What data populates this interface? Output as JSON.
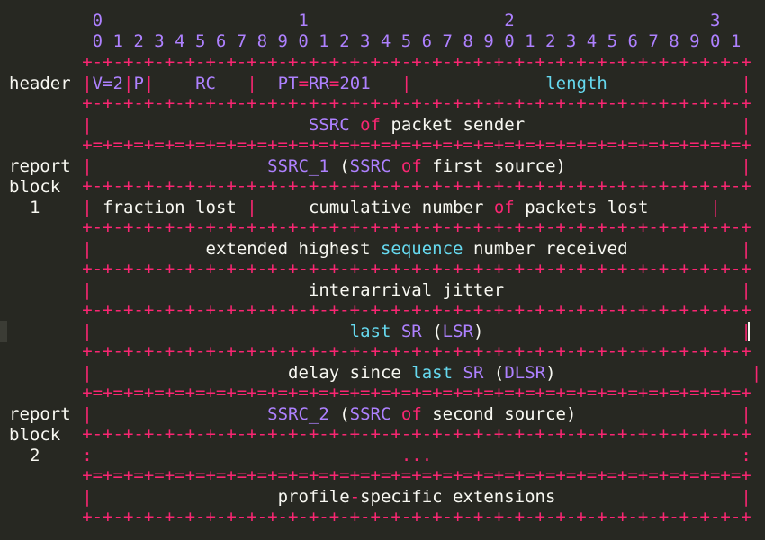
{
  "left_labels": {
    "header": "header",
    "block1": [
      "report",
      "block",
      "1"
    ],
    "block2": [
      "report",
      "block",
      "2"
    ]
  },
  "ruler": {
    "tens": "      0                   1                   2                   3",
    "units": "      0 1 2 3 4 5 6 7 8 9 0 1 2 3 4 5 6 7 8 9 0 1 2 3 4 5 6 7 8 9 0 1"
  },
  "borders": {
    "plus": "     +-+-+-+-+-+-+-+-+-+-+-+-+-+-+-+-+-+-+-+-+-+-+-+-+-+-+-+-+-+-+-+-+",
    "equals": "     +=+=+=+=+=+=+=+=+=+=+=+=+=+=+=+=+=+=+=+=+=+=+=+=+=+=+=+=+=+=+=+=+"
  },
  "fields": {
    "v": "V=2",
    "p": "P",
    "rc": "RC",
    "pt_pt": "PT",
    "pt_eq": "=",
    "pt_rr": "RR",
    "pt_eq2": "=",
    "pt_num": "201",
    "length": "length",
    "ssrc_a": "SSRC",
    "of_a": "of",
    "packet_sender": "packet sender",
    "ssrc1": "SSRC_1",
    "ssrc1_paren": "(",
    "ssrc1_ssrc": "SSRC",
    "ssrc1_of": "of",
    "ssrc1_rest": "first source)",
    "fraction_lost": "fraction lost",
    "cum_a": "cumulative number",
    "cum_of": "of",
    "cum_b": "packets lost",
    "ext_a": "extended highest",
    "ext_seq": "sequence",
    "ext_b": "number received",
    "jitter": "interarrival jitter",
    "lsr_last": "last",
    "lsr_sr": "SR",
    "lsr_open": "(",
    "lsr_lsr": "LSR",
    "lsr_close": ")",
    "dlsr_a": "delay since",
    "dlsr_last": "last",
    "dlsr_sr": "SR",
    "dlsr_open": "(",
    "dlsr_dlsr": "DLSR",
    "dlsr_close": ")",
    "ssrc2": "SSRC_2",
    "ssrc2_paren": "(",
    "ssrc2_ssrc": "SSRC",
    "ssrc2_of": "of",
    "ssrc2_rest": "second source)",
    "dots": "...",
    "profile_a": "profile",
    "profile_dash": "-",
    "profile_b": "specific extensions"
  },
  "colors": {
    "background": "#272822",
    "text": "#f8f8f2",
    "pink": "#f92672",
    "purple": "#ae81ff",
    "cyan": "#66d9ef"
  }
}
